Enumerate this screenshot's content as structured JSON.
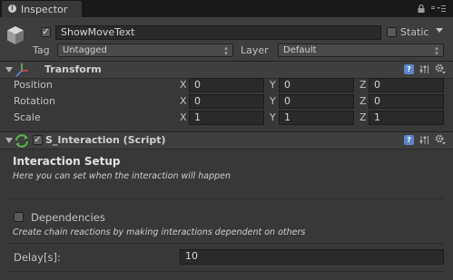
{
  "window": {
    "tab_label": "Inspector"
  },
  "object": {
    "active": true,
    "name": "ShowMoveText",
    "static_label": "Static",
    "static_checked": false,
    "tag_label": "Tag",
    "tag_value": "Untagged",
    "layer_label": "Layer",
    "layer_value": "Default"
  },
  "transform": {
    "title": "Transform",
    "rows": [
      {
        "label": "Position",
        "x": "0",
        "y": "0",
        "z": "0"
      },
      {
        "label": "Rotation",
        "x": "0",
        "y": "0",
        "z": "0"
      },
      {
        "label": "Scale",
        "x": "1",
        "y": "1",
        "z": "1"
      }
    ],
    "axis": {
      "x": "X",
      "y": "Y",
      "z": "Z"
    }
  },
  "script": {
    "title": "S_Interaction (Script)",
    "enabled": true,
    "section_title": "Interaction Setup",
    "section_desc": "Here you can set when the interaction will happen",
    "dependencies_label": "Dependencies",
    "dependencies_checked": false,
    "dependencies_desc": "Create chain reactions by making interactions dependent on others",
    "delay_label": "Delay[s]:",
    "delay_value": "10"
  },
  "icons": {
    "help": "?",
    "check": "✓"
  }
}
